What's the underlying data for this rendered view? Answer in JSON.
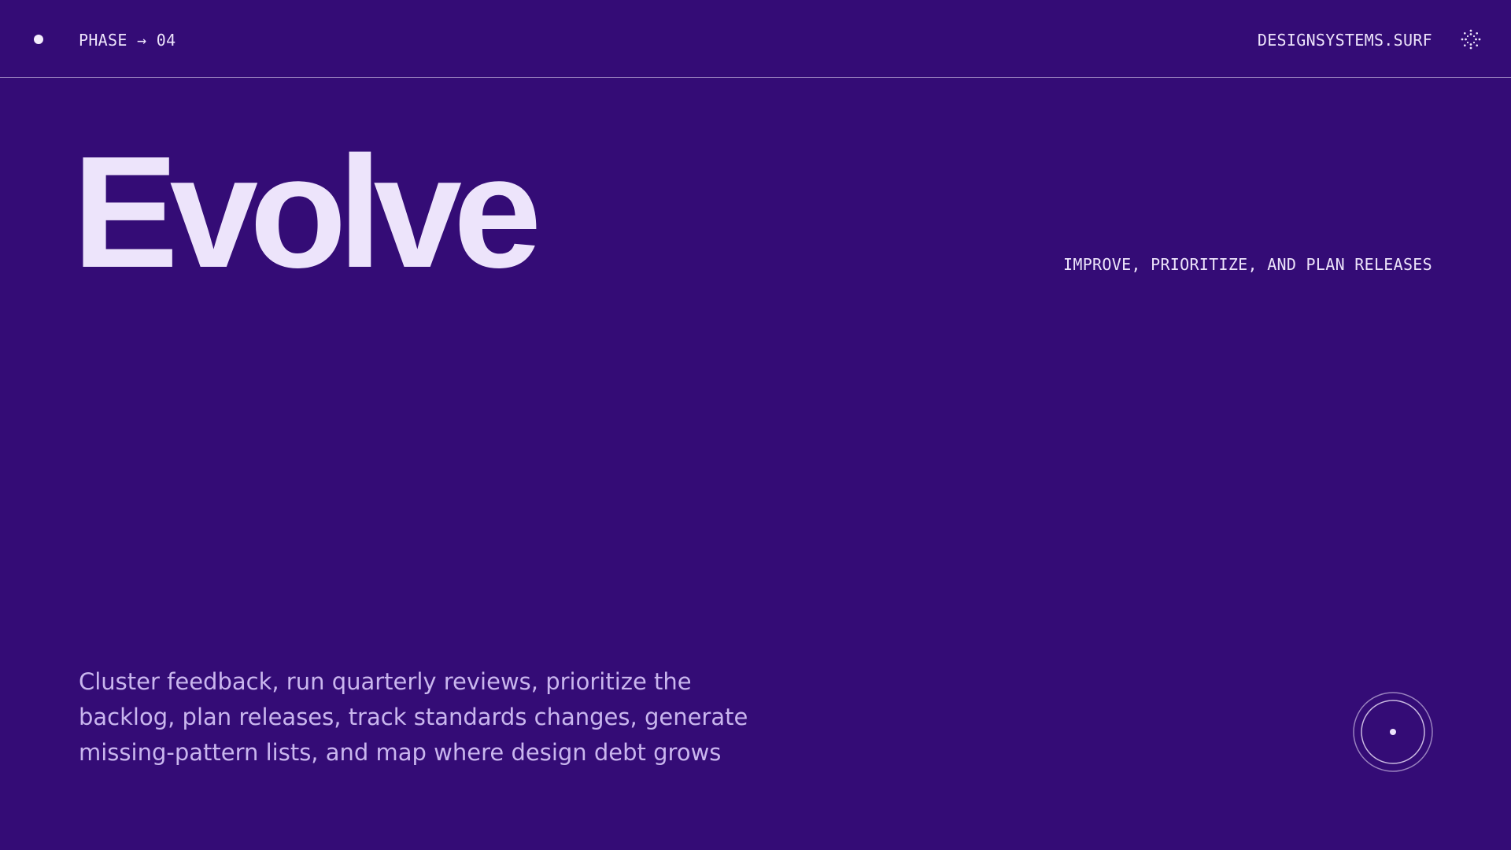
{
  "header": {
    "phase_label": "PHASE → 04",
    "site_name": "DESIGNSYSTEMS.SURF",
    "status_dot_icon": "dot-icon",
    "menu_icon": "sparkle-icon"
  },
  "hero": {
    "title": "Evolve",
    "tagline": "IMPROVE, PRIORITIZE, AND PLAN RELEASES"
  },
  "body": {
    "description": "Cluster feedback, run quarterly reviews, prioritize the backlog, plan releases, track standards changes, generate missing-pattern lists, and map where design debt grows"
  },
  "footer": {
    "corner_icon": "target-icon"
  },
  "colors": {
    "background": "#340c76",
    "foreground": "#ede4fb",
    "muted_text": "#c9b6ee"
  }
}
